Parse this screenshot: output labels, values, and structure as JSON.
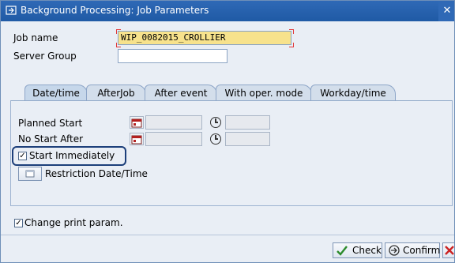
{
  "window": {
    "title": "Background Processing: Job Parameters",
    "close_glyph": "✕"
  },
  "fields": {
    "job_name_label": "Job name",
    "job_name_value": "WIP_0082015_CROLLIER",
    "server_group_label": "Server Group",
    "server_group_value": ""
  },
  "tabs": [
    {
      "label": "Date/time"
    },
    {
      "label": "AfterJob"
    },
    {
      "label": "After event"
    },
    {
      "label": "With oper. mode"
    },
    {
      "label": "Workday/time"
    }
  ],
  "datetime": {
    "planned_start_label": "Planned Start",
    "no_start_after_label": "No Start After",
    "start_immediately_label": "Start Immediately",
    "start_immediately_checked": true,
    "restriction_label": "Restriction Date/Time"
  },
  "print": {
    "change_print_label": "Change print param.",
    "change_print_checked": true
  },
  "actions": {
    "check_label": "Check",
    "confirm_label": "Confirm"
  },
  "colors": {
    "titlebar": "#1f5aa5",
    "required_field": "#f7e28c",
    "highlight_box": "#1c3f7a"
  }
}
